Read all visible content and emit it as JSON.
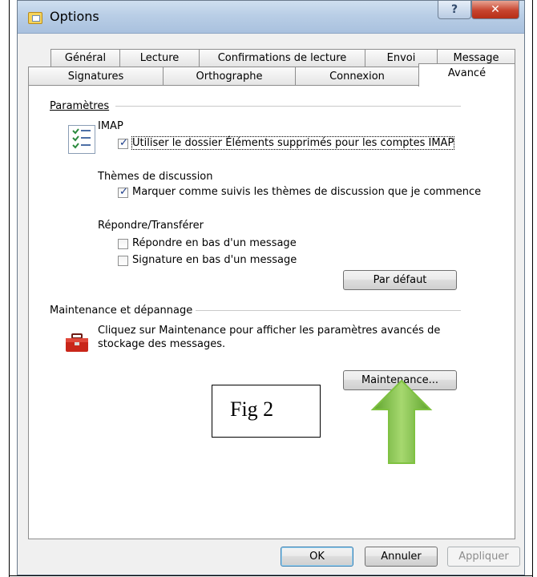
{
  "window": {
    "title": "Options"
  },
  "tabs": {
    "row1": [
      "Général",
      "Lecture",
      "Confirmations de lecture",
      "Envoi",
      "Message"
    ],
    "row2": [
      "Signatures",
      "Orthographe",
      "Connexion",
      "Avancé"
    ],
    "active": "Avancé"
  },
  "settings": {
    "group_label": "Paramètres",
    "imap": {
      "heading": "IMAP",
      "use_deleted_folder": {
        "label": "Utiliser le dossier Éléments supprimés pour les comptes IMAP",
        "checked": true
      }
    },
    "threads": {
      "heading": "Thèmes de discussion",
      "watch_threads": {
        "label": "Marquer comme suivis les thèmes de discussion que je commence",
        "checked": true
      }
    },
    "reply": {
      "heading": "Répondre/Transférer",
      "reply_bottom": {
        "label": "Répondre en bas d'un message",
        "checked": false
      },
      "signature_bottom": {
        "label": "Signature en bas d'un message",
        "checked": false
      }
    },
    "default_button": "Par défaut"
  },
  "maintenance": {
    "group_label": "Maintenance et dépannage",
    "description_line1": "Cliquez sur Maintenance pour afficher les paramètres avancés de",
    "description_line2": "stockage des messages.",
    "button": "Maintenance..."
  },
  "annotation": {
    "label": "Fig 2",
    "arrow_color": "#7fc241"
  },
  "footer": {
    "ok": "OK",
    "cancel": "Annuler",
    "apply": "Appliquer"
  }
}
